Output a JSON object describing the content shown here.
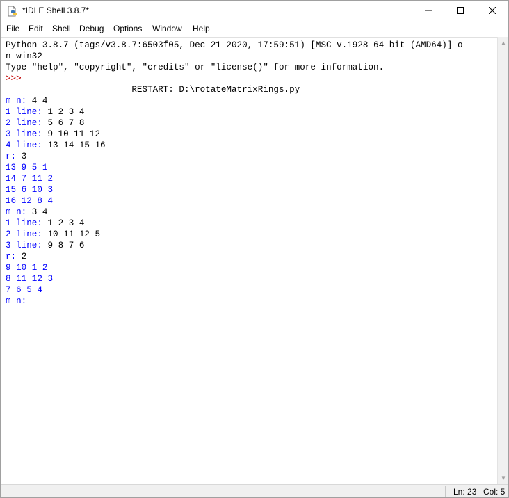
{
  "window": {
    "title": "*IDLE Shell 3.8.7*"
  },
  "menu": [
    "File",
    "Edit",
    "Shell",
    "Debug",
    "Options",
    "Window",
    "Help"
  ],
  "shell": {
    "lines": [
      {
        "text": "Python 3.8.7 (tags/v3.8.7:6503f05, Dec 21 2020, 17:59:51) [MSC v.1928 64 bit (AMD64)] o",
        "style": "output"
      },
      {
        "text": "n win32",
        "style": "output"
      },
      {
        "text": "Type \"help\", \"copyright\", \"credits\" or \"license()\" for more information.",
        "style": "output"
      },
      {
        "text": ">>> ",
        "style": "prompt"
      },
      {
        "text": "======================= RESTART: D:\\rotateMatrixRings.py =======================",
        "style": "output"
      },
      {
        "text": "m n: ",
        "style": "blue",
        "input": "4 4"
      },
      {
        "text": "1 line: ",
        "style": "blue",
        "input": "1 2 3 4"
      },
      {
        "text": "2 line: ",
        "style": "blue",
        "input": "5 6 7 8"
      },
      {
        "text": "3 line: ",
        "style": "blue",
        "input": "9 10 11 12"
      },
      {
        "text": "4 line: ",
        "style": "blue",
        "input": "13 14 15 16"
      },
      {
        "text": "r: ",
        "style": "blue",
        "input": "3"
      },
      {
        "text": "13 9 5 1",
        "style": "blue"
      },
      {
        "text": "14 7 11 2",
        "style": "blue"
      },
      {
        "text": "15 6 10 3",
        "style": "blue"
      },
      {
        "text": "16 12 8 4",
        "style": "blue"
      },
      {
        "text": "m n: ",
        "style": "blue",
        "input": "3 4"
      },
      {
        "text": "1 line: ",
        "style": "blue",
        "input": "1 2 3 4"
      },
      {
        "text": "2 line: ",
        "style": "blue",
        "input": "10 11 12 5"
      },
      {
        "text": "3 line: ",
        "style": "blue",
        "input": "9 8 7 6"
      },
      {
        "text": "r: ",
        "style": "blue",
        "input": "2"
      },
      {
        "text": "9 10 1 2",
        "style": "blue"
      },
      {
        "text": "8 11 12 3",
        "style": "blue"
      },
      {
        "text": "7 6 5 4",
        "style": "blue"
      },
      {
        "text": "m n: ",
        "style": "blue"
      }
    ]
  },
  "status": {
    "line": "Ln: 23",
    "col": "Col: 5"
  },
  "icons": {
    "app": "idle-python-file-icon",
    "minimize": "minimize-icon",
    "maximize": "maximize-icon",
    "close": "close-icon"
  }
}
